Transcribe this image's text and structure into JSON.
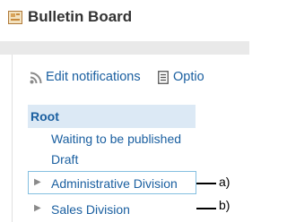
{
  "header": {
    "title": "Bulletin Board",
    "icon": "bulletin-board-icon"
  },
  "toolbar": {
    "edit_notifications": "Edit notifications",
    "options": "Optio"
  },
  "tree": {
    "root": "Root",
    "waiting": "Waiting to be published",
    "draft": "Draft",
    "categories": [
      {
        "label": "Administrative Division",
        "callout": "a)"
      },
      {
        "label": "Sales Division",
        "callout": "b)"
      }
    ]
  },
  "colors": {
    "link": "#1a5fa0",
    "selected_bg": "#dce9f5",
    "highlight_border": "#84bfe0"
  }
}
